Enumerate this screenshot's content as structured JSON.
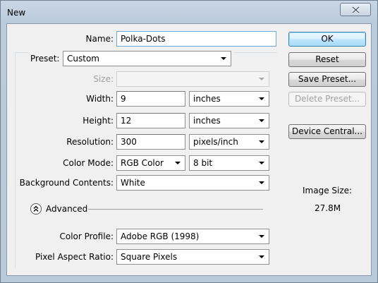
{
  "window": {
    "title": "New"
  },
  "form": {
    "name_label": "Name:",
    "name_value": "Polka-Dots",
    "preset_label": "Preset:",
    "preset_value": "Custom",
    "size_label": "Size:",
    "size_value": "",
    "width_label": "Width:",
    "width_value": "9",
    "width_unit": "inches",
    "height_label": "Height:",
    "height_value": "12",
    "height_unit": "inches",
    "resolution_label": "Resolution:",
    "resolution_value": "300",
    "resolution_unit": "pixels/inch",
    "color_mode_label": "Color Mode:",
    "color_mode_value": "RGB Color",
    "bit_depth_value": "8 bit",
    "background_label": "Background Contents:",
    "background_value": "White",
    "advanced_label": "Advanced",
    "color_profile_label": "Color Profile:",
    "color_profile_value": "Adobe RGB (1998)",
    "pixel_aspect_label": "Pixel Aspect Ratio:",
    "pixel_aspect_value": "Square Pixels"
  },
  "buttons": {
    "ok": "OK",
    "reset": "Reset",
    "save_preset": "Save Preset...",
    "delete_preset": "Delete Preset...",
    "device_central": "Device Central..."
  },
  "info": {
    "image_size_label": "Image Size:",
    "image_size_value": "27.8M"
  },
  "icons": {
    "close": "close-icon",
    "advanced": "double-chevron-up-icon",
    "dropdown": "chevron-down-icon"
  }
}
